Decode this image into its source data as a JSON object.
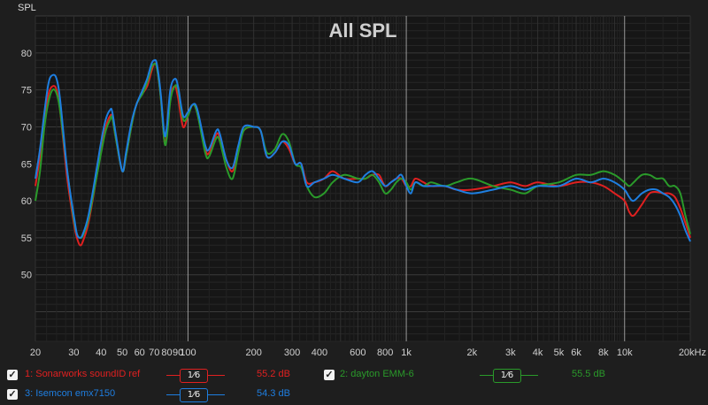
{
  "chart_data": {
    "type": "line",
    "title": "All SPL",
    "ylabel": "SPL",
    "xlabel": "",
    "x_scale": "log",
    "xlim": [
      20,
      20000
    ],
    "ylim": [
      41,
      85
    ],
    "x_ticks": [
      {
        "v": 20,
        "label": "20"
      },
      {
        "v": 30,
        "label": "30"
      },
      {
        "v": 40,
        "label": "40"
      },
      {
        "v": 50,
        "label": "50"
      },
      {
        "v": 60,
        "label": "60"
      },
      {
        "v": 70,
        "label": "70"
      },
      {
        "v": 80,
        "label": "80"
      },
      {
        "v": 90,
        "label": "90"
      },
      {
        "v": 100,
        "label": "100"
      },
      {
        "v": 200,
        "label": "200"
      },
      {
        "v": 300,
        "label": "300"
      },
      {
        "v": 400,
        "label": "400"
      },
      {
        "v": 600,
        "label": "600"
      },
      {
        "v": 800,
        "label": "800"
      },
      {
        "v": 1000,
        "label": "1k"
      },
      {
        "v": 2000,
        "label": "2k"
      },
      {
        "v": 3000,
        "label": "3k"
      },
      {
        "v": 4000,
        "label": "4k"
      },
      {
        "v": 5000,
        "label": "5k"
      },
      {
        "v": 6000,
        "label": "6k"
      },
      {
        "v": 8000,
        "label": "8k"
      },
      {
        "v": 10000,
        "label": "10k"
      },
      {
        "v": 20000,
        "label": "20kHz"
      }
    ],
    "y_ticks": [
      {
        "v": 50,
        "label": "50"
      },
      {
        "v": 55,
        "label": "55"
      },
      {
        "v": 60,
        "label": "60"
      },
      {
        "v": 65,
        "label": "65"
      },
      {
        "v": 70,
        "label": "70"
      },
      {
        "v": 75,
        "label": "75"
      },
      {
        "v": 80,
        "label": "80"
      }
    ],
    "series": [
      {
        "name": "1: Sonarworks soundID ref",
        "color": "#e02020",
        "offset": "55.2 dB",
        "smoothing": "1/6",
        "points": [
          [
            20,
            62
          ],
          [
            21,
            66
          ],
          [
            22,
            71
          ],
          [
            23,
            74.5
          ],
          [
            24,
            75.5
          ],
          [
            25,
            75
          ],
          [
            26,
            72
          ],
          [
            28,
            63
          ],
          [
            30,
            57
          ],
          [
            31,
            55
          ],
          [
            32,
            54
          ],
          [
            33,
            54.5
          ],
          [
            35,
            57
          ],
          [
            38,
            63
          ],
          [
            40,
            67
          ],
          [
            42,
            70
          ],
          [
            44,
            71.5
          ],
          [
            45,
            71.2
          ],
          [
            47,
            68
          ],
          [
            50,
            64
          ],
          [
            52,
            66
          ],
          [
            55,
            70
          ],
          [
            58,
            73
          ],
          [
            62,
            74.5
          ],
          [
            65,
            75.5
          ],
          [
            68,
            77.5
          ],
          [
            70,
            78.5
          ],
          [
            72,
            78
          ],
          [
            75,
            74
          ],
          [
            78,
            68
          ],
          [
            80,
            69
          ],
          [
            83,
            74
          ],
          [
            87,
            75.5
          ],
          [
            90,
            74
          ],
          [
            95,
            70
          ],
          [
            100,
            71.5
          ],
          [
            105,
            73
          ],
          [
            110,
            72
          ],
          [
            120,
            67
          ],
          [
            125,
            66.5
          ],
          [
            135,
            69
          ],
          [
            140,
            68.5
          ],
          [
            150,
            65.5
          ],
          [
            160,
            64
          ],
          [
            170,
            67
          ],
          [
            180,
            69.5
          ],
          [
            200,
            70
          ],
          [
            215,
            69.5
          ],
          [
            230,
            66
          ],
          [
            250,
            66.5
          ],
          [
            270,
            68
          ],
          [
            290,
            67
          ],
          [
            310,
            65
          ],
          [
            330,
            65
          ],
          [
            350,
            62.5
          ],
          [
            380,
            62.5
          ],
          [
            420,
            63
          ],
          [
            460,
            64
          ],
          [
            520,
            63
          ],
          [
            600,
            63
          ],
          [
            650,
            63
          ],
          [
            700,
            63.5
          ],
          [
            750,
            63.5
          ],
          [
            800,
            62
          ],
          [
            850,
            62.5
          ],
          [
            900,
            63
          ],
          [
            950,
            63
          ],
          [
            1000,
            62
          ],
          [
            1050,
            62
          ],
          [
            1100,
            63
          ],
          [
            1200,
            62.5
          ],
          [
            1300,
            62
          ],
          [
            1500,
            62
          ],
          [
            1700,
            61.5
          ],
          [
            2000,
            61.5
          ],
          [
            2500,
            62
          ],
          [
            3000,
            62.5
          ],
          [
            3500,
            62
          ],
          [
            4000,
            62.5
          ],
          [
            5000,
            62
          ],
          [
            6000,
            62.5
          ],
          [
            7000,
            62.5
          ],
          [
            8000,
            62
          ],
          [
            9000,
            61
          ],
          [
            10000,
            60
          ],
          [
            10500,
            58.5
          ],
          [
            11000,
            58
          ],
          [
            12000,
            59.5
          ],
          [
            13000,
            61
          ],
          [
            14000,
            61.2
          ],
          [
            15000,
            61
          ],
          [
            16000,
            61
          ],
          [
            17000,
            60.5
          ],
          [
            18000,
            59
          ],
          [
            19000,
            57
          ],
          [
            20000,
            55
          ]
        ]
      },
      {
        "name": "2: dayton EMM-6",
        "color": "#2a9a2a",
        "offset": "55.5 dB",
        "smoothing": "1/6",
        "points": [
          [
            20,
            60
          ],
          [
            21,
            64
          ],
          [
            22,
            70
          ],
          [
            23,
            73.5
          ],
          [
            24,
            75
          ],
          [
            25,
            74.5
          ],
          [
            26,
            72
          ],
          [
            28,
            64
          ],
          [
            30,
            57.5
          ],
          [
            31,
            55.5
          ],
          [
            32,
            55
          ],
          [
            33,
            55.3
          ],
          [
            35,
            57.5
          ],
          [
            38,
            63
          ],
          [
            40,
            66.5
          ],
          [
            42,
            69.5
          ],
          [
            44,
            71
          ],
          [
            45,
            71.2
          ],
          [
            47,
            68
          ],
          [
            50,
            64
          ],
          [
            52,
            66
          ],
          [
            55,
            70
          ],
          [
            58,
            73
          ],
          [
            62,
            74.5
          ],
          [
            65,
            76
          ],
          [
            68,
            78
          ],
          [
            70,
            78.5
          ],
          [
            72,
            78
          ],
          [
            75,
            74
          ],
          [
            78,
            68
          ],
          [
            80,
            68.5
          ],
          [
            83,
            73.5
          ],
          [
            87,
            75.5
          ],
          [
            90,
            75
          ],
          [
            95,
            71
          ],
          [
            100,
            71.5
          ],
          [
            105,
            73
          ],
          [
            110,
            72
          ],
          [
            120,
            66.5
          ],
          [
            125,
            66
          ],
          [
            135,
            68.5
          ],
          [
            140,
            68
          ],
          [
            150,
            64.5
          ],
          [
            160,
            63
          ],
          [
            170,
            66.5
          ],
          [
            180,
            69.5
          ],
          [
            200,
            70
          ],
          [
            215,
            69.5
          ],
          [
            230,
            66.5
          ],
          [
            250,
            67
          ],
          [
            270,
            69
          ],
          [
            290,
            68
          ],
          [
            310,
            65
          ],
          [
            330,
            64.5
          ],
          [
            350,
            62
          ],
          [
            380,
            60.5
          ],
          [
            420,
            61
          ],
          [
            460,
            62.5
          ],
          [
            520,
            63.5
          ],
          [
            600,
            63
          ],
          [
            650,
            63
          ],
          [
            700,
            63.5
          ],
          [
            750,
            62.5
          ],
          [
            800,
            61
          ],
          [
            850,
            61.5
          ],
          [
            900,
            62.5
          ],
          [
            950,
            63
          ],
          [
            1000,
            62.5
          ],
          [
            1050,
            61.5
          ],
          [
            1100,
            62.5
          ],
          [
            1200,
            62
          ],
          [
            1300,
            62.5
          ],
          [
            1500,
            62
          ],
          [
            1700,
            62.5
          ],
          [
            2000,
            63
          ],
          [
            2500,
            62
          ],
          [
            3000,
            61.5
          ],
          [
            3500,
            61
          ],
          [
            4000,
            62
          ],
          [
            5000,
            62.5
          ],
          [
            6000,
            63.5
          ],
          [
            7000,
            63.5
          ],
          [
            8000,
            64
          ],
          [
            9000,
            63.5
          ],
          [
            10000,
            62.5
          ],
          [
            10500,
            62
          ],
          [
            11000,
            62.5
          ],
          [
            12000,
            63.5
          ],
          [
            13000,
            63.5
          ],
          [
            14000,
            63
          ],
          [
            15000,
            63
          ],
          [
            16000,
            62
          ],
          [
            17000,
            62
          ],
          [
            18000,
            61
          ],
          [
            19000,
            58
          ],
          [
            20000,
            55.5
          ]
        ]
      },
      {
        "name": "3: Isemcon emx7150",
        "color": "#1e7ee0",
        "offset": "54.3 dB",
        "smoothing": "1/6",
        "points": [
          [
            20,
            63
          ],
          [
            21,
            67
          ],
          [
            22,
            72
          ],
          [
            23,
            76
          ],
          [
            24,
            77
          ],
          [
            25,
            76.5
          ],
          [
            26,
            73.5
          ],
          [
            28,
            64
          ],
          [
            30,
            58
          ],
          [
            31,
            55.5
          ],
          [
            32,
            55
          ],
          [
            33,
            55.5
          ],
          [
            35,
            58
          ],
          [
            38,
            64
          ],
          [
            40,
            68
          ],
          [
            42,
            71
          ],
          [
            44,
            72.3
          ],
          [
            45,
            72
          ],
          [
            47,
            68.5
          ],
          [
            50,
            64
          ],
          [
            52,
            66.5
          ],
          [
            55,
            70.5
          ],
          [
            58,
            73
          ],
          [
            62,
            75
          ],
          [
            65,
            76.5
          ],
          [
            68,
            78.5
          ],
          [
            70,
            79
          ],
          [
            72,
            78.5
          ],
          [
            75,
            74.5
          ],
          [
            78,
            69
          ],
          [
            80,
            70
          ],
          [
            83,
            75
          ],
          [
            87,
            76.5
          ],
          [
            90,
            75.5
          ],
          [
            95,
            71.5
          ],
          [
            100,
            72
          ],
          [
            105,
            73
          ],
          [
            110,
            72.5
          ],
          [
            120,
            67.5
          ],
          [
            125,
            67
          ],
          [
            135,
            69.5
          ],
          [
            140,
            69
          ],
          [
            150,
            65.5
          ],
          [
            160,
            64.5
          ],
          [
            170,
            67.5
          ],
          [
            180,
            70
          ],
          [
            200,
            70
          ],
          [
            215,
            69.5
          ],
          [
            230,
            66
          ],
          [
            250,
            66.5
          ],
          [
            270,
            68
          ],
          [
            290,
            67.5
          ],
          [
            310,
            65
          ],
          [
            330,
            65
          ],
          [
            350,
            62
          ],
          [
            380,
            62.5
          ],
          [
            420,
            63
          ],
          [
            460,
            63.5
          ],
          [
            520,
            63
          ],
          [
            600,
            62.5
          ],
          [
            650,
            63.5
          ],
          [
            700,
            64
          ],
          [
            750,
            63
          ],
          [
            800,
            62
          ],
          [
            850,
            62.5
          ],
          [
            900,
            63
          ],
          [
            950,
            63.5
          ],
          [
            1000,
            62
          ],
          [
            1050,
            61
          ],
          [
            1100,
            62.5
          ],
          [
            1200,
            62
          ],
          [
            1300,
            62
          ],
          [
            1500,
            62
          ],
          [
            1700,
            61.5
          ],
          [
            2000,
            61
          ],
          [
            2500,
            61.5
          ],
          [
            3000,
            62
          ],
          [
            3500,
            61.5
          ],
          [
            4000,
            62
          ],
          [
            5000,
            62
          ],
          [
            6000,
            63
          ],
          [
            7000,
            62.5
          ],
          [
            8000,
            63
          ],
          [
            9000,
            62.5
          ],
          [
            10000,
            61.5
          ],
          [
            10500,
            60.5
          ],
          [
            11000,
            60
          ],
          [
            12000,
            61
          ],
          [
            13000,
            61.5
          ],
          [
            14000,
            61.5
          ],
          [
            15000,
            61
          ],
          [
            16000,
            60.5
          ],
          [
            17000,
            59.5
          ],
          [
            18000,
            58
          ],
          [
            19000,
            56
          ],
          [
            20000,
            54.5
          ]
        ]
      }
    ]
  },
  "legend": [
    {
      "checked": "✓",
      "label": "1: Sonarworks soundID ref",
      "smoothing": "1⁄6",
      "offset": "55.2 dB"
    },
    {
      "checked": "✓",
      "label": "2: dayton EMM-6",
      "smoothing": "1⁄6",
      "offset": "55.5 dB"
    },
    {
      "checked": "✓",
      "label": "3: Isemcon emx7150",
      "smoothing": "1⁄6",
      "offset": "54.3 dB"
    }
  ]
}
